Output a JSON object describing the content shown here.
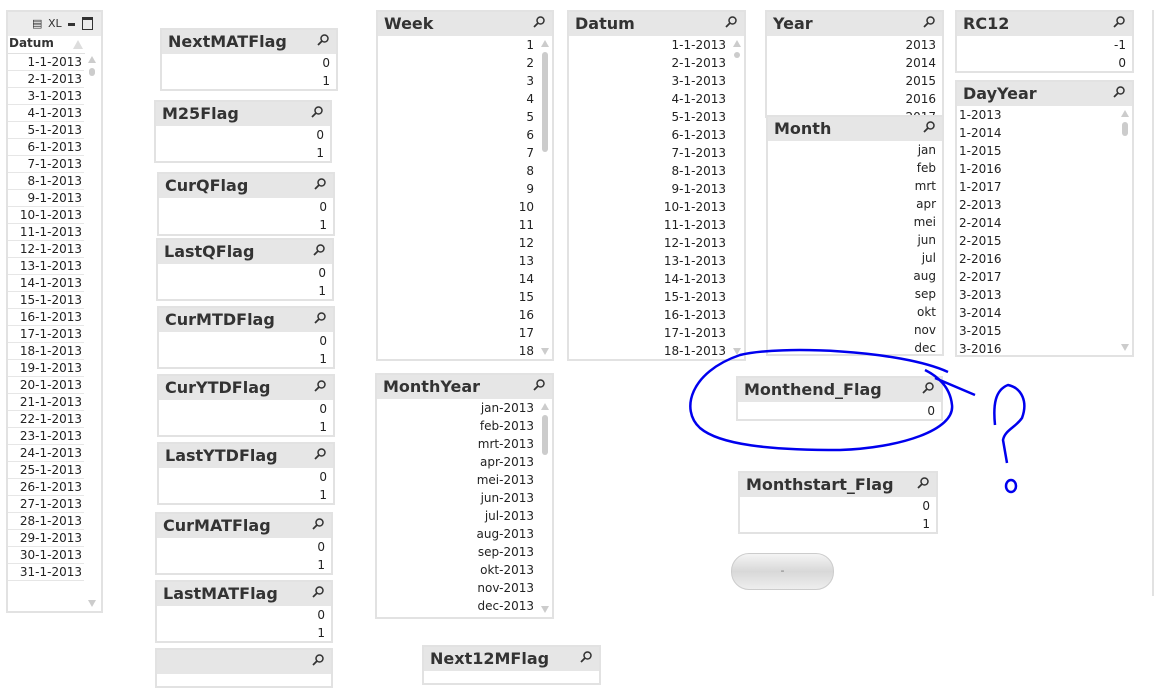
{
  "table_box": {
    "toolbar": {
      "print_icon": "print-icon",
      "xl_label": "XL",
      "minimize_icon": "minimize-icon",
      "maximize_icon": "maximize-icon"
    },
    "column_header": "Datum",
    "rows": [
      "1-1-2013",
      "2-1-2013",
      "3-1-2013",
      "4-1-2013",
      "5-1-2013",
      "6-1-2013",
      "7-1-2013",
      "8-1-2013",
      "9-1-2013",
      "10-1-2013",
      "11-1-2013",
      "12-1-2013",
      "13-1-2013",
      "14-1-2013",
      "15-1-2013",
      "16-1-2013",
      "17-1-2013",
      "18-1-2013",
      "19-1-2013",
      "20-1-2013",
      "21-1-2013",
      "22-1-2013",
      "23-1-2013",
      "24-1-2013",
      "25-1-2013",
      "26-1-2013",
      "27-1-2013",
      "28-1-2013",
      "29-1-2013",
      "30-1-2013",
      "31-1-2013"
    ]
  },
  "listboxes": [
    {
      "id": "nextmatflag",
      "title": "NextMATFlag",
      "values": [
        "0",
        "1"
      ]
    },
    {
      "id": "m25flag",
      "title": "M25Flag",
      "values": [
        "0",
        "1"
      ]
    },
    {
      "id": "curqflag",
      "title": "CurQFlag",
      "values": [
        "0",
        "1"
      ]
    },
    {
      "id": "lastqflag",
      "title": "LastQFlag",
      "values": [
        "0",
        "1"
      ]
    },
    {
      "id": "curmtdflag",
      "title": "CurMTDFlag",
      "values": [
        "0",
        "1"
      ]
    },
    {
      "id": "curytdflag",
      "title": "CurYTDFlag",
      "values": [
        "0",
        "1"
      ]
    },
    {
      "id": "lastytdflag",
      "title": "LastYTDFlag",
      "values": [
        "0",
        "1"
      ]
    },
    {
      "id": "curmatflag",
      "title": "CurMATFlag",
      "values": [
        "0",
        "1"
      ]
    },
    {
      "id": "lastmatflag",
      "title": "LastMATFlag",
      "values": [
        "0",
        "1"
      ]
    },
    {
      "id": "partial-left",
      "title": "",
      "values": []
    },
    {
      "id": "week",
      "title": "Week",
      "scroll": true,
      "values": [
        "1",
        "2",
        "3",
        "4",
        "5",
        "6",
        "7",
        "8",
        "9",
        "10",
        "11",
        "12",
        "13",
        "14",
        "15",
        "16",
        "17",
        "18"
      ]
    },
    {
      "id": "datum",
      "title": "Datum",
      "scroll": true,
      "values": [
        "1-1-2013",
        "2-1-2013",
        "3-1-2013",
        "4-1-2013",
        "5-1-2013",
        "6-1-2013",
        "7-1-2013",
        "8-1-2013",
        "9-1-2013",
        "10-1-2013",
        "11-1-2013",
        "12-1-2013",
        "13-1-2013",
        "14-1-2013",
        "15-1-2013",
        "16-1-2013",
        "17-1-2013",
        "18-1-2013"
      ]
    },
    {
      "id": "year",
      "title": "Year",
      "values": [
        "2013",
        "2014",
        "2015",
        "2016",
        "2017"
      ]
    },
    {
      "id": "month",
      "title": "Month",
      "values": [
        "jan",
        "feb",
        "mrt",
        "apr",
        "mei",
        "jun",
        "jul",
        "aug",
        "sep",
        "okt",
        "nov",
        "dec"
      ]
    },
    {
      "id": "rc12",
      "title": "RC12",
      "values": [
        "-1",
        "0"
      ]
    },
    {
      "id": "dayyear",
      "title": "DayYear",
      "scroll": true,
      "left": true,
      "values": [
        "1-2013",
        "1-2014",
        "1-2015",
        "1-2016",
        "1-2017",
        "2-2013",
        "2-2014",
        "2-2015",
        "2-2016",
        "2-2017",
        "3-2013",
        "3-2014",
        "3-2015",
        "3-2016"
      ]
    },
    {
      "id": "monthyear",
      "title": "MonthYear",
      "scroll": true,
      "values": [
        "jan-2013",
        "feb-2013",
        "mrt-2013",
        "apr-2013",
        "mei-2013",
        "jun-2013",
        "jul-2013",
        "aug-2013",
        "sep-2013",
        "okt-2013",
        "nov-2013",
        "dec-2013"
      ]
    },
    {
      "id": "monthend_flag",
      "title": "Monthend_Flag",
      "values": [
        "0"
      ]
    },
    {
      "id": "monthstart_flag",
      "title": "Monthstart_Flag",
      "values": [
        "0",
        "1"
      ]
    },
    {
      "id": "next12mflag",
      "title": "Next12MFlag",
      "values": []
    }
  ],
  "button": {
    "label": "-"
  },
  "annotation": {
    "color": "#0000ee",
    "shape": "hand-drawn circle around Monthend_Flag with question mark"
  }
}
